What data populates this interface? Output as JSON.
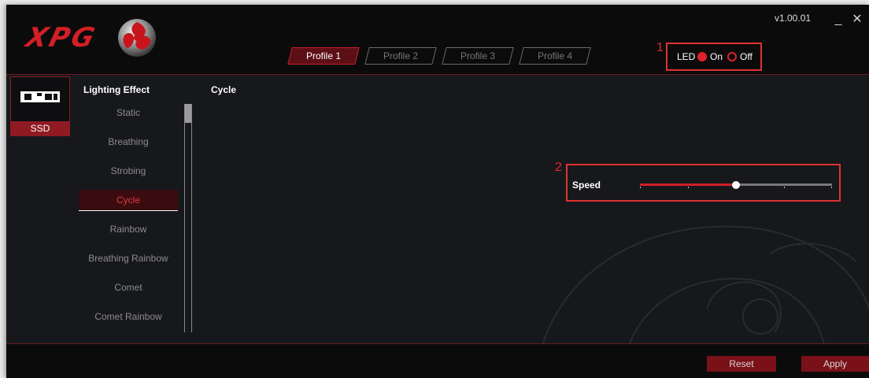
{
  "app": {
    "logo_text": "XPG",
    "version": "v1.00.01",
    "minimize_symbol": "_",
    "close_symbol": "✕"
  },
  "profiles": [
    "Profile 1",
    "Profile 2",
    "Profile 3",
    "Profile 4"
  ],
  "active_profile": "Profile 1",
  "annotations": [
    "1",
    "2"
  ],
  "led": {
    "label": "LED",
    "on_label": "On",
    "off_label": "Off",
    "selected": "On"
  },
  "device": {
    "label": "SSD",
    "icon": "ssd-icon"
  },
  "lighting": {
    "title": "Lighting Effect",
    "selected_effect_title": "Cycle",
    "effects": [
      "Static",
      "Breathing",
      "Strobing",
      "Cycle",
      "Rainbow",
      "Breathing Rainbow",
      "Comet",
      "Comet Rainbow"
    ],
    "selected": "Cycle"
  },
  "speed": {
    "label": "Speed",
    "level": 0.5,
    "ticks": 5
  },
  "colors": {
    "accent": "#d41f26",
    "background": "#17181b",
    "highlight_box": "#e03232"
  },
  "footer": {
    "reset_label": "Reset",
    "apply_label": "Apply"
  }
}
